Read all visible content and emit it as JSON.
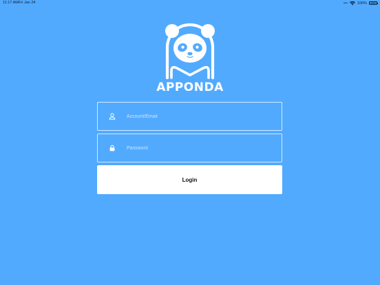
{
  "status_bar": {
    "time": "11:17 AM",
    "date": "Fri Jan 24",
    "dots": "•••",
    "battery_percent": "100%",
    "icons": [
      "wifi-icon",
      "battery-icon"
    ]
  },
  "brand": {
    "name": "APPONDA",
    "logo_icon": "panda-logo"
  },
  "form": {
    "account": {
      "placeholder": "Account/Email",
      "value": "",
      "icon": "user-icon"
    },
    "password": {
      "placeholder": "Password",
      "value": "",
      "icon": "lock-icon"
    },
    "login_label": "Login"
  },
  "colors": {
    "background": "#52aaff",
    "text_on_bg": "#ffffff",
    "button_bg": "#ffffff",
    "button_text": "#111111"
  }
}
